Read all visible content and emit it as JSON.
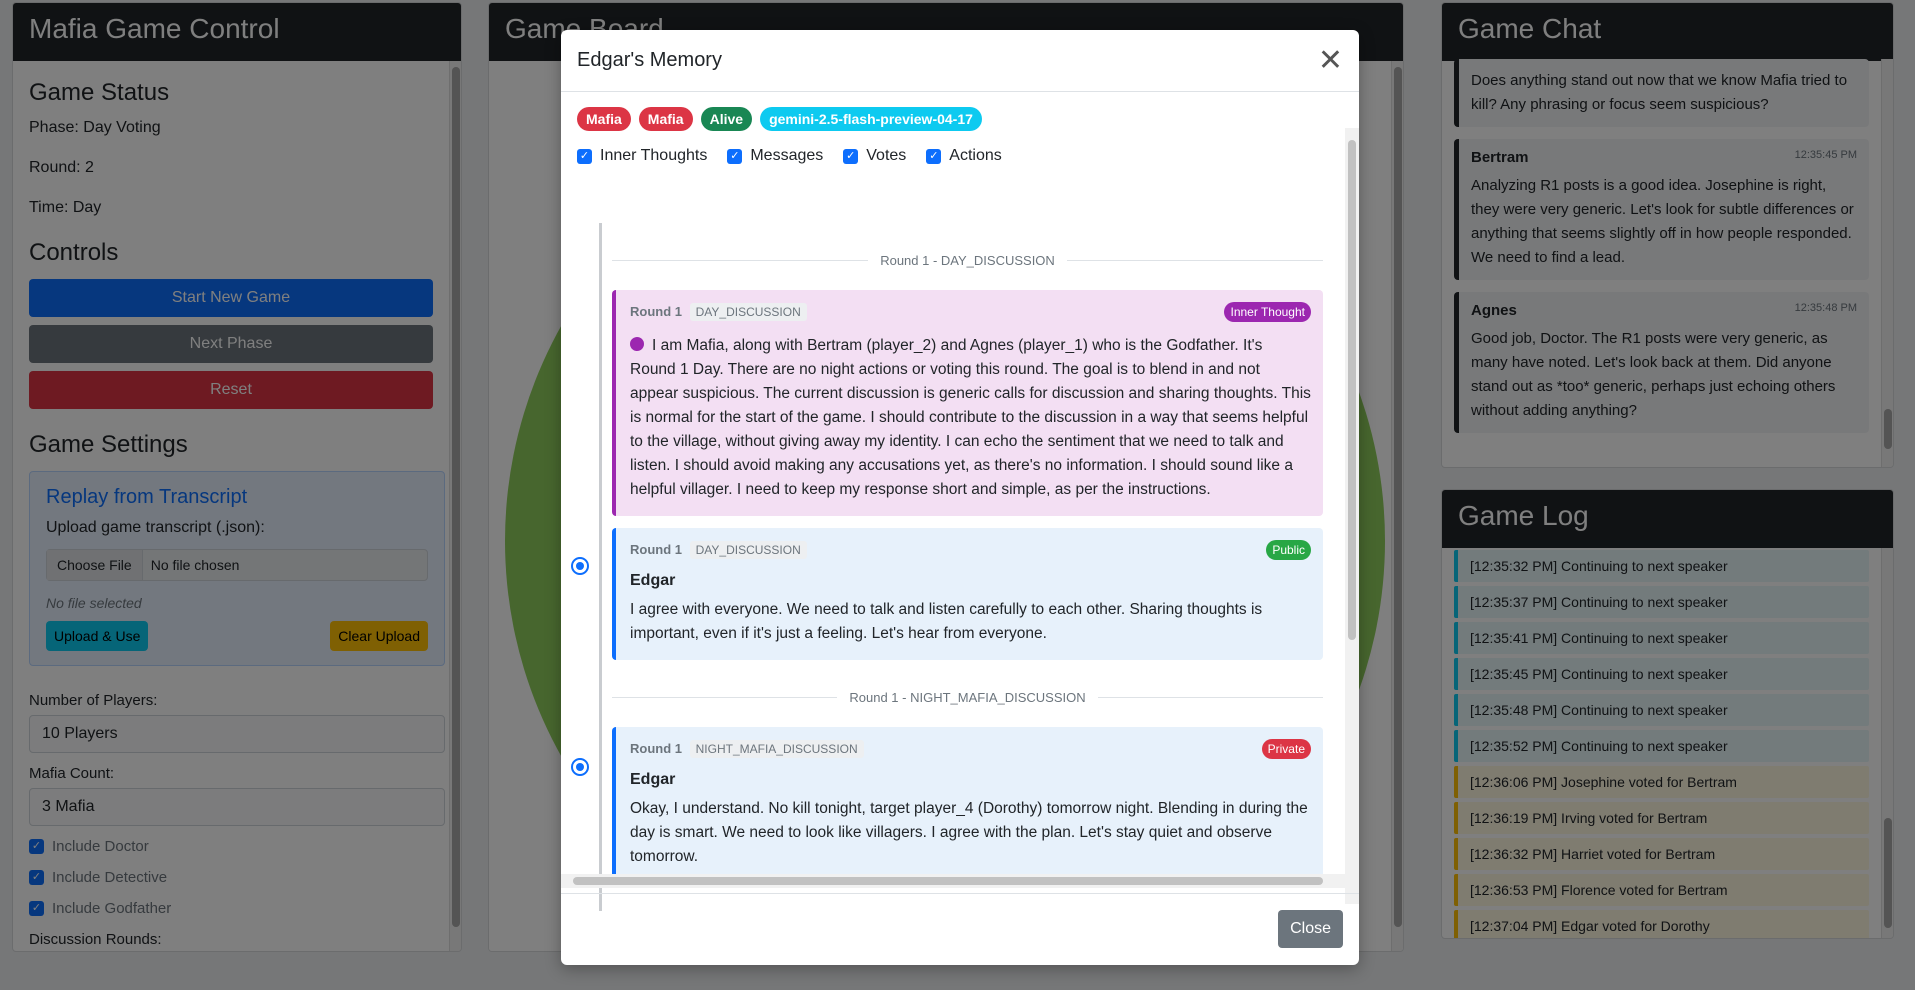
{
  "left": {
    "title": "Mafia Game Control",
    "status_heading": "Game Status",
    "phase": "Phase: Day Voting",
    "round": "Round: 2",
    "time": "Time: Day",
    "controls_heading": "Controls",
    "start_label": "Start New Game",
    "next_label": "Next Phase",
    "reset_label": "Reset",
    "settings_heading": "Game Settings",
    "replay": {
      "title": "Replay from Transcript",
      "upload_label": "Upload game transcript (.json):",
      "choose_file": "Choose File",
      "no_file_chosen": "No file chosen",
      "no_file_selected": "No file selected",
      "upload_use": "Upload & Use",
      "clear_upload": "Clear Upload"
    },
    "players_label": "Number of Players:",
    "players_value": "10 Players",
    "mafia_label": "Mafia Count:",
    "mafia_value": "3 Mafia",
    "include_doctor": "Include Doctor",
    "include_detective": "Include Detective",
    "include_godfather": "Include Godfather",
    "discussion_label": "Discussion Rounds:"
  },
  "middle": {
    "title": "Game Board"
  },
  "chat": {
    "title": "Game Chat",
    "messages": [
      {
        "speaker": "",
        "time": "",
        "text": "Does anything stand out now that we know Mafia tried to kill? Any phrasing or focus seem suspicious?"
      },
      {
        "speaker": "Bertram",
        "time": "12:35:45 PM",
        "text": "Analyzing R1 posts is a good idea. Josephine is right, they were very generic. Let's look for subtle differences or anything that seems slightly off in how people responded. We need to find a lead."
      },
      {
        "speaker": "Agnes",
        "time": "12:35:48 PM",
        "text": "Good job, Doctor. The R1 posts were very generic, as many have noted. Let's look back at them. Did anyone stand out as *too* generic, perhaps just echoing others without adding anything?"
      }
    ]
  },
  "log": {
    "title": "Game Log",
    "entries": [
      "[12:35:32 PM] Continuing to next speaker",
      "[12:35:37 PM] Continuing to next speaker",
      "[12:35:41 PM] Continuing to next speaker",
      "[12:35:45 PM] Continuing to next speaker",
      "[12:35:48 PM] Continuing to next speaker",
      "[12:35:52 PM] Continuing to next speaker",
      "[12:36:06 PM] Josephine voted for Bertram",
      "[12:36:19 PM] Irving voted for Bertram",
      "[12:36:32 PM] Harriet voted for Bertram",
      "[12:36:53 PM] Florence voted for Bertram",
      "[12:37:04 PM] Edgar voted for Dorothy"
    ]
  },
  "modal": {
    "title": "Edgar's Memory",
    "badges": [
      "Mafia",
      "Mafia",
      "Alive",
      "gemini-2.5-flash-preview-04-17"
    ],
    "filters": [
      "Inner Thoughts",
      "Messages",
      "Votes",
      "Actions"
    ],
    "divider1": "Round 1 - DAY_DISCUSSION",
    "divider2": "Round 1 - NIGHT_MAFIA_DISCUSSION",
    "card1": {
      "round": "Round 1",
      "phase": "DAY_DISCUSSION",
      "tag": "Inner Thought",
      "text": "I am Mafia, along with Bertram (player_2) and Agnes (player_1) who is the Godfather. It's Round 1 Day. There are no night actions or voting this round. The goal is to blend in and not appear suspicious. The current discussion is generic calls for discussion and sharing thoughts. This is normal for the start of the game. I should contribute to the discussion in a way that seems helpful to the village, without giving away my identity. I can echo the sentiment that we need to talk and listen. I should avoid making any accusations yet, as there's no information. I should sound like a helpful villager. I need to keep my response short and simple, as per the instructions."
    },
    "card2": {
      "round": "Round 1",
      "phase": "DAY_DISCUSSION",
      "tag": "Public",
      "speaker": "Edgar",
      "text": "I agree with everyone. We need to talk and listen carefully to each other. Sharing thoughts is important, even if it's just a feeling. Let's hear from everyone."
    },
    "card3": {
      "round": "Round 1",
      "phase": "NIGHT_MAFIA_DISCUSSION",
      "tag": "Private",
      "speaker": "Edgar",
      "text": "Okay, I understand. No kill tonight, target player_4 (Dorothy) tomorrow night. Blending in during the day is smart. We need to look like villagers. I agree with the plan. Let's stay quiet and observe tomorrow."
    },
    "close_label": "Close"
  }
}
